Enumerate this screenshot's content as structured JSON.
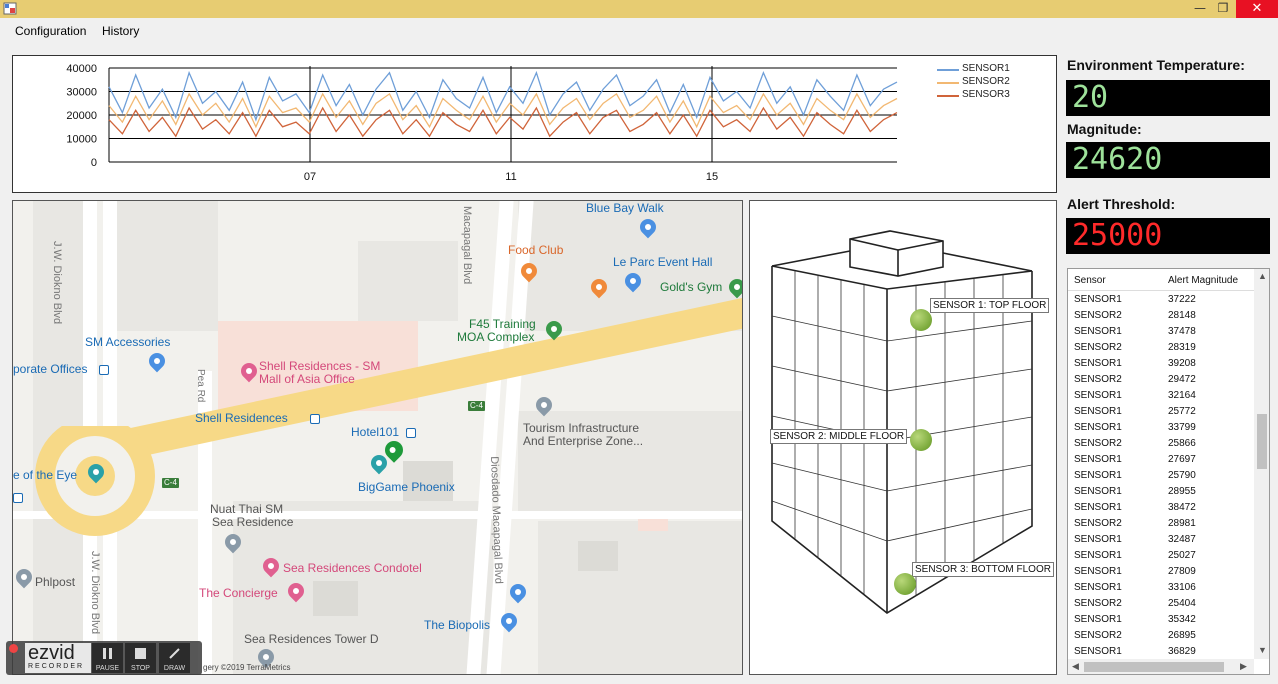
{
  "menu": {
    "configuration": "Configuration",
    "history": "History"
  },
  "chart_data": {
    "type": "line",
    "x_ticks": [
      "07",
      "11",
      "15"
    ],
    "y_ticks": [
      "40000",
      "30000",
      "20000",
      "10000",
      "0"
    ],
    "ylim": [
      0,
      40000
    ],
    "series": [
      {
        "name": "SENSOR1",
        "color": "#6f9fd8",
        "values": [
          32000,
          21000,
          37000,
          23000,
          31000,
          19000,
          38000,
          25000,
          30000,
          22000,
          34000,
          18000,
          36000,
          26000,
          29000,
          21000,
          37000,
          24000,
          33000,
          20000,
          31000,
          38000,
          22000,
          30000,
          19000,
          35000,
          27000,
          23000,
          36000,
          21000,
          32000,
          25000,
          38000,
          20000,
          29000,
          34000,
          22000,
          31000,
          37000,
          24000,
          28000,
          35000,
          21000,
          33000,
          19000,
          36000,
          26000,
          30000,
          23000,
          38000,
          25000,
          32000,
          20000,
          35000,
          28000,
          22000,
          37000,
          24000,
          31000,
          34000
        ]
      },
      {
        "name": "SENSOR2",
        "color": "#f2b872",
        "values": [
          24000,
          17000,
          28000,
          18000,
          26000,
          16000,
          29000,
          20000,
          25000,
          17000,
          27000,
          15000,
          28000,
          21000,
          23000,
          17000,
          29000,
          19000,
          26000,
          16000,
          25000,
          29000,
          18000,
          24000,
          15000,
          27000,
          22000,
          18000,
          28000,
          17000,
          25000,
          20000,
          29000,
          16000,
          23000,
          27000,
          18000,
          25000,
          29000,
          19000,
          22000,
          28000,
          17000,
          26000,
          15000,
          28000,
          21000,
          24000,
          18000,
          29000,
          20000,
          25000,
          16000,
          27000,
          22000,
          18000,
          29000,
          19000,
          24000,
          27000
        ]
      },
      {
        "name": "SENSOR3",
        "color": "#d0643a",
        "values": [
          18000,
          12000,
          22000,
          13000,
          19000,
          11000,
          23000,
          14000,
          18000,
          12000,
          21000,
          11000,
          22000,
          15000,
          17000,
          12000,
          23000,
          13000,
          20000,
          11000,
          18000,
          22000,
          12000,
          18000,
          11000,
          21000,
          16000,
          13000,
          22000,
          12000,
          19000,
          14000,
          23000,
          11000,
          17000,
          21000,
          12000,
          19000,
          22000,
          13000,
          16000,
          21000,
          12000,
          20000,
          11000,
          22000,
          15000,
          18000,
          13000,
          23000,
          14000,
          19000,
          11000,
          21000,
          16000,
          12000,
          22000,
          13000,
          18000,
          21000
        ]
      }
    ]
  },
  "map": {
    "labels": {
      "blue_bay": "Blue Bay Walk",
      "food_club": "Food Club",
      "le_parc": "Le Parc Event Hall",
      "golds": "Gold's Gym",
      "sm_accessories": "SM Accessories",
      "corporate_offices": "porate Offices",
      "shell_sm_1": "Shell Residences - SM",
      "shell_sm_2": "Mall of Asia Office",
      "f45_1": "F45 Training",
      "f45_2": "MOA Complex",
      "shell_res": "Shell Residences",
      "hotel101": "Hotel101",
      "tourism_1": "Tourism Infrastructure",
      "tourism_2": "And Enterprise Zone...",
      "eye": "e of the Eye",
      "bigame": "BigGame Phoenix",
      "nuat_1": "Nuat Thai SM",
      "nuat_2": "Sea Residence",
      "sea_condotel": "Sea Residences Condotel",
      "concierge": "The Concierge",
      "philpost": "Phlpost",
      "sea_tower": "Sea Residences Tower D",
      "biopolis": "The Biopolis",
      "diokno": "J.W. Diokno Blvd",
      "diokno2": "J.W. Diokno Blvd",
      "macapagal_top": "Macapagal Blvd",
      "diosdado": "Diosdado Macapagal Blvd",
      "pea_rd": "Pea Rd",
      "c4": "C-4",
      "credit": "gery ©2019 TerraMetrics"
    }
  },
  "ezvid": {
    "logo": "ezvid",
    "sub": "RECORDER",
    "pause": "PAUSE",
    "stop": "STOP",
    "draw": "DRAW"
  },
  "building": {
    "sensor1": "SENSOR 1: TOP FLOOR",
    "sensor2": "SENSOR 2: MIDDLE FLOOR",
    "sensor3": "SENSOR 3: BOTTOM FLOOR"
  },
  "side": {
    "env_temp_label": "Environment Temperature:",
    "env_temp_value": "20",
    "magnitude_label": "Magnitude:",
    "magnitude_value": "24620",
    "threshold_label": "Alert Threshold:",
    "threshold_value": "25000"
  },
  "alerts": {
    "headers": {
      "sensor": "Sensor",
      "magnitude": "Alert Magnitude"
    },
    "rows": [
      [
        "SENSOR1",
        "37222"
      ],
      [
        "SENSOR2",
        "28148"
      ],
      [
        "SENSOR1",
        "37478"
      ],
      [
        "SENSOR2",
        "28319"
      ],
      [
        "SENSOR1",
        "39208"
      ],
      [
        "SENSOR2",
        "29472"
      ],
      [
        "SENSOR1",
        "32164"
      ],
      [
        "SENSOR1",
        "25772"
      ],
      [
        "SENSOR1",
        "33799"
      ],
      [
        "SENSOR2",
        "25866"
      ],
      [
        "SENSOR1",
        "27697"
      ],
      [
        "SENSOR1",
        "25790"
      ],
      [
        "SENSOR1",
        "28955"
      ],
      [
        "SENSOR1",
        "38472"
      ],
      [
        "SENSOR2",
        "28981"
      ],
      [
        "SENSOR1",
        "32487"
      ],
      [
        "SENSOR1",
        "25027"
      ],
      [
        "SENSOR1",
        "27809"
      ],
      [
        "SENSOR1",
        "33106"
      ],
      [
        "SENSOR2",
        "25404"
      ],
      [
        "SENSOR1",
        "35342"
      ],
      [
        "SENSOR2",
        "26895"
      ],
      [
        "SENSOR1",
        "36829"
      ]
    ]
  }
}
